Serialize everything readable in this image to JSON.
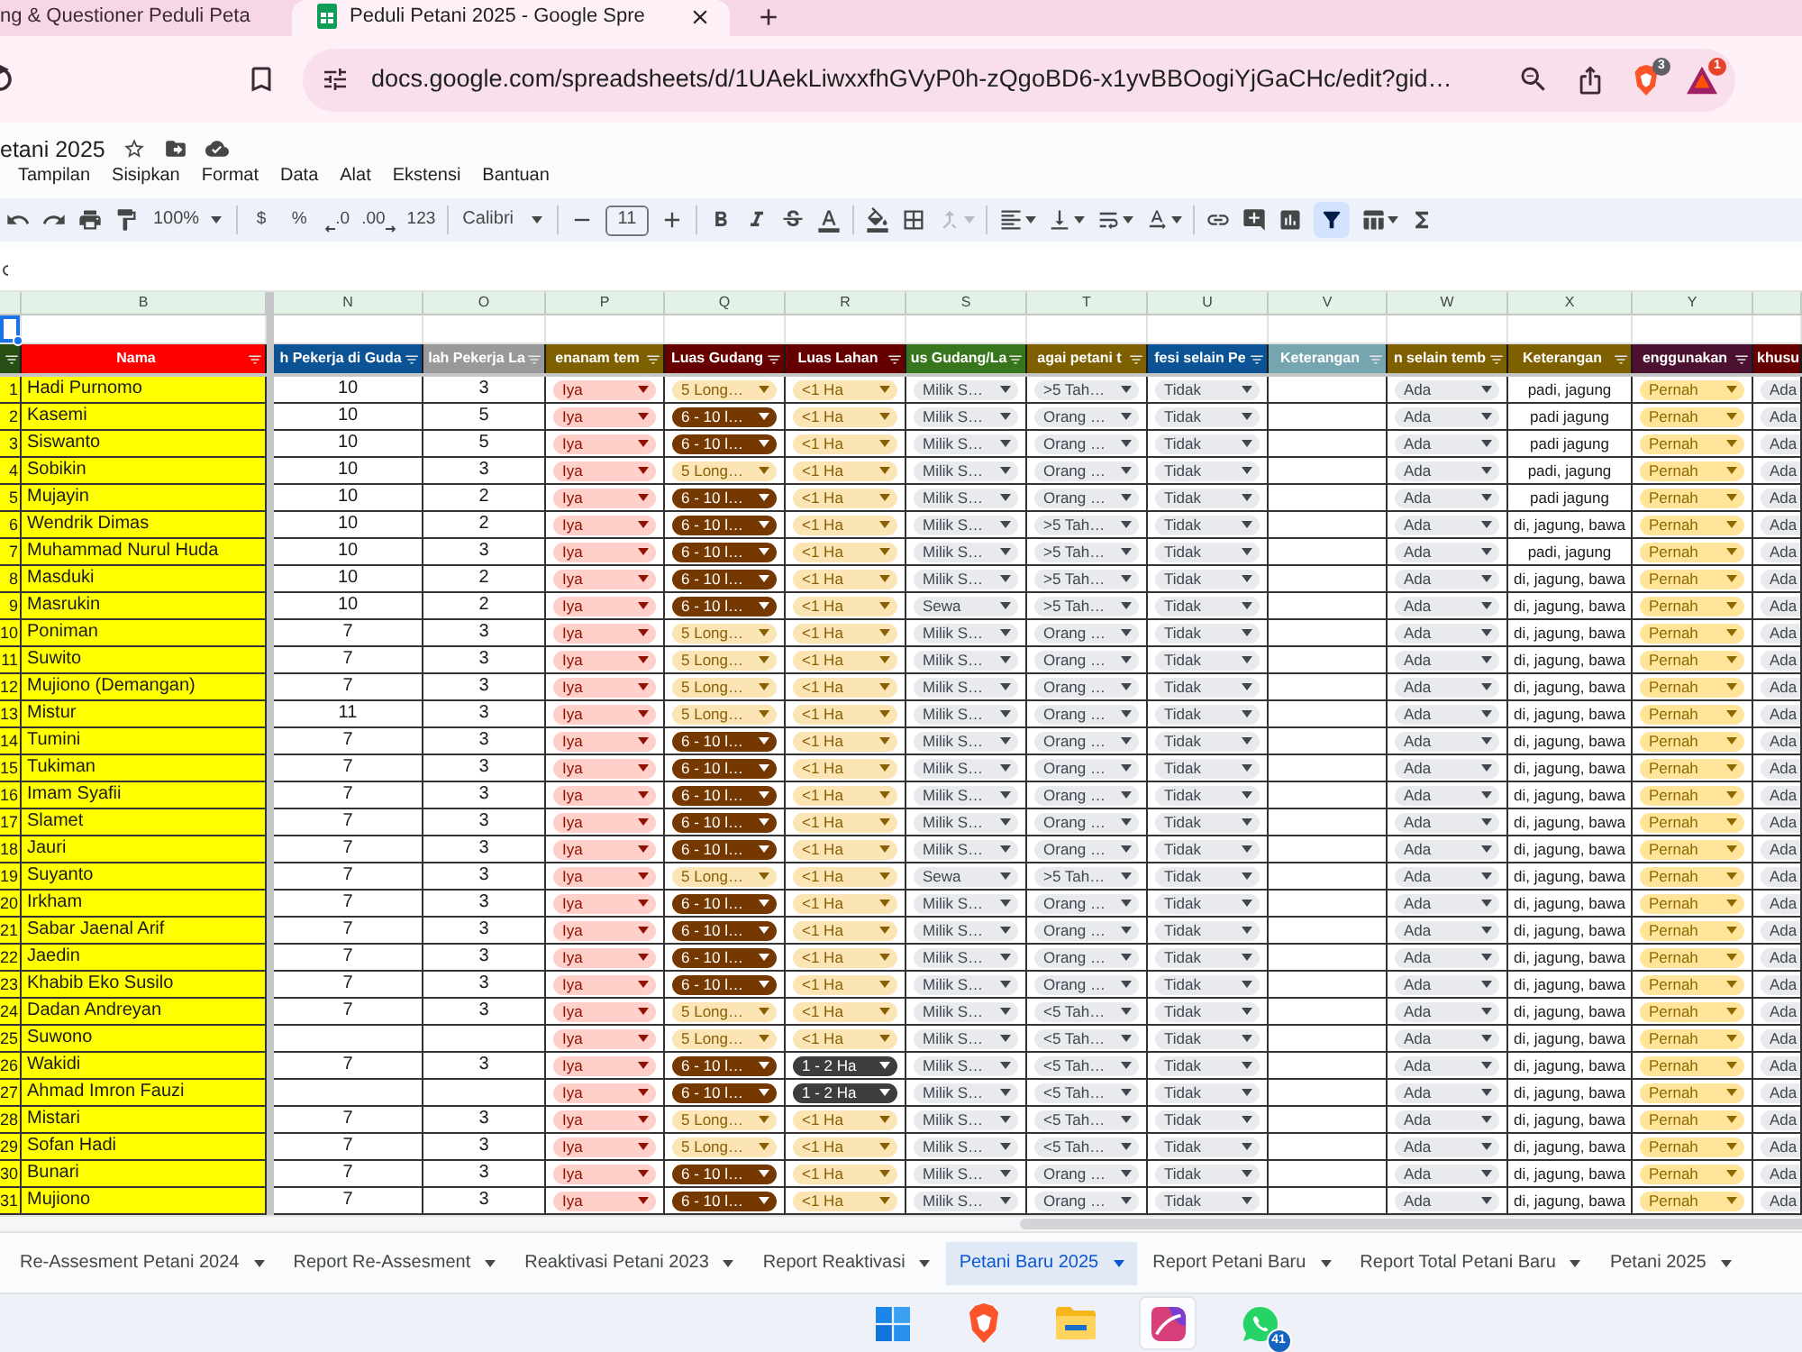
{
  "browser": {
    "tabs": [
      {
        "title": "ng & Questioner Peduli Peta",
        "selected": false
      },
      {
        "title": "Peduli Petani 2025 - Google Spre",
        "selected": true
      }
    ],
    "url": "docs.google.com/spreadsheets/d/1UAekLiwxxfhGVyP0h-zQgoBD6-x1yvBBOogiYjGaCHc/edit?gid…",
    "extensions": [
      {
        "kind": "shield",
        "badge": "3"
      },
      {
        "kind": "triangle",
        "badge": "1"
      }
    ]
  },
  "document": {
    "title": "etani 2025"
  },
  "menu": [
    "Tampilan",
    "Sisipkan",
    "Format",
    "Data",
    "Alat",
    "Ekstensi",
    "Bantuan"
  ],
  "toolbar": {
    "zoom": "100%",
    "formats": [
      {
        "label": "$",
        "kind": "plain"
      },
      {
        "label": "%",
        "kind": "plain"
      },
      {
        "label": ".0",
        "kind": "decrease"
      },
      {
        "label": ".00",
        "kind": "increase"
      },
      {
        "label": "123",
        "kind": "plain"
      }
    ],
    "font": "Calibri",
    "font_size": "11",
    "merge_disabled": true,
    "filter_on": true
  },
  "sheet": {
    "columns": [
      {
        "color": "#274e13",
        "kind": "index",
        "selected": true
      },
      {
        "letter": "B",
        "header": "Nama",
        "color": "#ff0000",
        "kind": "name",
        "selected": false
      },
      {
        "letter": "N",
        "header": "h Pekerja di Guda",
        "color": "#0b5394",
        "kind": "number",
        "selected": false
      },
      {
        "letter": "O",
        "header": "lah Pekerja La",
        "color": "#999999",
        "kind": "number",
        "selected": false
      },
      {
        "letter": "P",
        "header": "enanam tem",
        "color": "#7f6000",
        "kind": "chip",
        "chip": {
          "color": "#ffcfc9"
        },
        "selected": false
      },
      {
        "letter": "Q",
        "header": "Luas Gudang",
        "color": "#660000",
        "kind": "chip",
        "selected": false
      },
      {
        "letter": "R",
        "header": "Luas Lahan",
        "color": "#660000",
        "kind": "chip",
        "selected": false
      },
      {
        "letter": "S",
        "header": "us Gudang/La",
        "color": "#38761d",
        "kind": "chip",
        "chip": {
          "color": "#e8eaed"
        },
        "selected": false
      },
      {
        "letter": "T",
        "header": "agai petani t",
        "color": "#7f6000",
        "kind": "chip",
        "chip": {
          "color": "#e8eaed"
        },
        "selected": false
      },
      {
        "letter": "U",
        "header": "fesi selain Pe",
        "color": "#0b5394",
        "kind": "chip",
        "chip": {
          "color": "#e8eaed"
        },
        "selected": false
      },
      {
        "letter": "V",
        "header": "Keterangan",
        "color": "#76a5af",
        "kind": "note",
        "selected": false
      },
      {
        "letter": "W",
        "header": "n selain temb",
        "color": "#7f6000",
        "kind": "chip",
        "chip": {
          "color": "#e8eaed"
        },
        "selected": false
      },
      {
        "letter": "X",
        "header": "Keterangan",
        "color": "#7f6000",
        "kind": "note",
        "selected": false
      },
      {
        "letter": "Y",
        "header": "enggunakan",
        "color": "#4c1130",
        "kind": "chip",
        "chip": {
          "color": "#ffe49a"
        },
        "selected": false
      },
      {
        "header": "khusu",
        "color": "#660000",
        "kind": "chip",
        "chip": {
          "color": "#e8eaed"
        },
        "cut": true,
        "selected": false
      }
    ],
    "rows": [
      {
        "cells": [
          "1",
          "Hadi Purnomo",
          "10",
          "3",
          "Iya",
          {
            "value": "5 Long…",
            "color": "#fce5b4"
          },
          {
            "value": "<1 Ha",
            "color": "#fce5b4"
          },
          "Milik S…",
          ">5 Tah…",
          "Tidak",
          null,
          "Ada",
          "padi, jagung",
          "Pernah",
          "Ada"
        ]
      },
      {
        "cells": [
          "2",
          "Kasemi",
          "10",
          "5",
          "Iya",
          {
            "value": "6 - 10 l…",
            "color": "#753800"
          },
          {
            "value": "<1 Ha",
            "color": "#fce5b4"
          },
          "Milik S…",
          "Orang …",
          "Tidak",
          null,
          "Ada",
          "padi jagung",
          "Pernah",
          "Ada"
        ]
      },
      {
        "cells": [
          "3",
          "Siswanto",
          "10",
          "5",
          "Iya",
          {
            "value": "6 - 10 l…",
            "color": "#753800"
          },
          {
            "value": "<1 Ha",
            "color": "#fce5b4"
          },
          "Milik S…",
          "Orang …",
          "Tidak",
          null,
          "Ada",
          "padi jagung",
          "Pernah",
          "Ada"
        ]
      },
      {
        "cells": [
          "4",
          "Sobikin",
          "10",
          "3",
          "Iya",
          {
            "value": "5 Long…",
            "color": "#fce5b4"
          },
          {
            "value": "<1 Ha",
            "color": "#fce5b4"
          },
          "Milik S…",
          "Orang …",
          "Tidak",
          null,
          "Ada",
          "padi, jagung",
          "Pernah",
          "Ada"
        ]
      },
      {
        "cells": [
          "5",
          "Mujayin",
          "10",
          "2",
          "Iya",
          {
            "value": "6 - 10 l…",
            "color": "#753800"
          },
          {
            "value": "<1 Ha",
            "color": "#fce5b4"
          },
          "Milik S…",
          "Orang …",
          "Tidak",
          null,
          "Ada",
          "padi jagung",
          "Pernah",
          "Ada"
        ]
      },
      {
        "cells": [
          "6",
          "Wendrik Dimas",
          "10",
          "2",
          "Iya",
          {
            "value": "6 - 10 l…",
            "color": "#753800"
          },
          {
            "value": "<1 Ha",
            "color": "#fce5b4"
          },
          "Milik S…",
          ">5 Tah…",
          "Tidak",
          null,
          "Ada",
          "di, jagung, bawa",
          "Pernah",
          "Ada"
        ]
      },
      {
        "cells": [
          "7",
          "Muhammad Nurul Huda",
          "10",
          "3",
          "Iya",
          {
            "value": "6 - 10 l…",
            "color": "#753800"
          },
          {
            "value": "<1 Ha",
            "color": "#fce5b4"
          },
          "Milik S…",
          ">5 Tah…",
          "Tidak",
          null,
          "Ada",
          "padi, jagung",
          "Pernah",
          "Ada"
        ]
      },
      {
        "cells": [
          "8",
          "Masduki",
          "10",
          "2",
          "Iya",
          {
            "value": "6 - 10 l…",
            "color": "#753800"
          },
          {
            "value": "<1 Ha",
            "color": "#fce5b4"
          },
          "Milik S…",
          ">5 Tah…",
          "Tidak",
          null,
          "Ada",
          "di, jagung, bawa",
          "Pernah",
          "Ada"
        ]
      },
      {
        "cells": [
          "9",
          "Masrukin",
          "10",
          "2",
          "Iya",
          {
            "value": "6 - 10 l…",
            "color": "#753800"
          },
          {
            "value": "<1 Ha",
            "color": "#fce5b4"
          },
          "Sewa",
          ">5 Tah…",
          "Tidak",
          null,
          "Ada",
          "di, jagung, bawa",
          "Pernah",
          "Ada"
        ]
      },
      {
        "cells": [
          "10",
          "Poniman",
          "7",
          "3",
          "Iya",
          {
            "value": "5 Long…",
            "color": "#fce5b4"
          },
          {
            "value": "<1 Ha",
            "color": "#fce5b4"
          },
          "Milik S…",
          "Orang …",
          "Tidak",
          null,
          "Ada",
          "di, jagung, bawa",
          "Pernah",
          "Ada"
        ]
      },
      {
        "cells": [
          "11",
          "Suwito",
          "7",
          "3",
          "Iya",
          {
            "value": "5 Long…",
            "color": "#fce5b4"
          },
          {
            "value": "<1 Ha",
            "color": "#fce5b4"
          },
          "Milik S…",
          "Orang …",
          "Tidak",
          null,
          "Ada",
          "di, jagung, bawa",
          "Pernah",
          "Ada"
        ]
      },
      {
        "cells": [
          "12",
          "Mujiono (Demangan)",
          "7",
          "3",
          "Iya",
          {
            "value": "5 Long…",
            "color": "#fce5b4"
          },
          {
            "value": "<1 Ha",
            "color": "#fce5b4"
          },
          "Milik S…",
          "Orang …",
          "Tidak",
          null,
          "Ada",
          "di, jagung, bawa",
          "Pernah",
          "Ada"
        ]
      },
      {
        "cells": [
          "13",
          "Mistur",
          "11",
          "3",
          "Iya",
          {
            "value": "5 Long…",
            "color": "#fce5b4"
          },
          {
            "value": "<1 Ha",
            "color": "#fce5b4"
          },
          "Milik S…",
          "Orang …",
          "Tidak",
          null,
          "Ada",
          "di, jagung, bawa",
          "Pernah",
          "Ada"
        ]
      },
      {
        "cells": [
          "14",
          "Tumini",
          "7",
          "3",
          "Iya",
          {
            "value": "6 - 10 l…",
            "color": "#753800"
          },
          {
            "value": "<1 Ha",
            "color": "#fce5b4"
          },
          "Milik S…",
          "Orang …",
          "Tidak",
          null,
          "Ada",
          "di, jagung, bawa",
          "Pernah",
          "Ada"
        ]
      },
      {
        "cells": [
          "15",
          "Tukiman",
          "7",
          "3",
          "Iya",
          {
            "value": "6 - 10 l…",
            "color": "#753800"
          },
          {
            "value": "<1 Ha",
            "color": "#fce5b4"
          },
          "Milik S…",
          "Orang …",
          "Tidak",
          null,
          "Ada",
          "di, jagung, bawa",
          "Pernah",
          "Ada"
        ]
      },
      {
        "cells": [
          "16",
          "Imam Syafii",
          "7",
          "3",
          "Iya",
          {
            "value": "6 - 10 l…",
            "color": "#753800"
          },
          {
            "value": "<1 Ha",
            "color": "#fce5b4"
          },
          "Milik S…",
          "Orang …",
          "Tidak",
          null,
          "Ada",
          "di, jagung, bawa",
          "Pernah",
          "Ada"
        ]
      },
      {
        "cells": [
          "17",
          "Slamet",
          "7",
          "3",
          "Iya",
          {
            "value": "6 - 10 l…",
            "color": "#753800"
          },
          {
            "value": "<1 Ha",
            "color": "#fce5b4"
          },
          "Milik S…",
          "Orang …",
          "Tidak",
          null,
          "Ada",
          "di, jagung, bawa",
          "Pernah",
          "Ada"
        ]
      },
      {
        "cells": [
          "18",
          "Jauri",
          "7",
          "3",
          "Iya",
          {
            "value": "6 - 10 l…",
            "color": "#753800"
          },
          {
            "value": "<1 Ha",
            "color": "#fce5b4"
          },
          "Milik S…",
          "Orang …",
          "Tidak",
          null,
          "Ada",
          "di, jagung, bawa",
          "Pernah",
          "Ada"
        ]
      },
      {
        "cells": [
          "19",
          "Suyanto",
          "7",
          "3",
          "Iya",
          {
            "value": "5 Long…",
            "color": "#fce5b4"
          },
          {
            "value": "<1 Ha",
            "color": "#fce5b4"
          },
          "Sewa",
          ">5 Tah…",
          "Tidak",
          null,
          "Ada",
          "di, jagung, bawa",
          "Pernah",
          "Ada"
        ]
      },
      {
        "cells": [
          "20",
          "Irkham",
          "7",
          "3",
          "Iya",
          {
            "value": "6 - 10 l…",
            "color": "#753800"
          },
          {
            "value": "<1 Ha",
            "color": "#fce5b4"
          },
          "Milik S…",
          "Orang …",
          "Tidak",
          null,
          "Ada",
          "di, jagung, bawa",
          "Pernah",
          "Ada"
        ]
      },
      {
        "cells": [
          "21",
          "Sabar Jaenal Arif",
          "7",
          "3",
          "Iya",
          {
            "value": "6 - 10 l…",
            "color": "#753800"
          },
          {
            "value": "<1 Ha",
            "color": "#fce5b4"
          },
          "Milik S…",
          "Orang …",
          "Tidak",
          null,
          "Ada",
          "di, jagung, bawa",
          "Pernah",
          "Ada"
        ]
      },
      {
        "cells": [
          "22",
          "Jaedin",
          "7",
          "3",
          "Iya",
          {
            "value": "6 - 10 l…",
            "color": "#753800"
          },
          {
            "value": "<1 Ha",
            "color": "#fce5b4"
          },
          "Milik S…",
          "Orang …",
          "Tidak",
          null,
          "Ada",
          "di, jagung, bawa",
          "Pernah",
          "Ada"
        ]
      },
      {
        "cells": [
          "23",
          "Khabib Eko Susilo",
          "7",
          "3",
          "Iya",
          {
            "value": "6 - 10 l…",
            "color": "#753800"
          },
          {
            "value": "<1 Ha",
            "color": "#fce5b4"
          },
          "Milik S…",
          "Orang …",
          "Tidak",
          null,
          "Ada",
          "di, jagung, bawa",
          "Pernah",
          "Ada"
        ]
      },
      {
        "cells": [
          "24",
          "Dadan Andreyan",
          "7",
          "3",
          "Iya",
          {
            "value": "5 Long…",
            "color": "#fce5b4"
          },
          {
            "value": "<1 Ha",
            "color": "#fce5b4"
          },
          "Milik S…",
          "<5 Tah…",
          "Tidak",
          null,
          "Ada",
          "di, jagung, bawa",
          "Pernah",
          "Ada"
        ]
      },
      {
        "cells": [
          "25",
          "Suwono",
          null,
          null,
          "Iya",
          {
            "value": "5 Long…",
            "color": "#fce5b4"
          },
          {
            "value": "<1 Ha",
            "color": "#fce5b4"
          },
          "Milik S…",
          "<5 Tah…",
          "Tidak",
          null,
          "Ada",
          "di, jagung, bawa",
          "Pernah",
          "Ada"
        ]
      },
      {
        "cells": [
          "26",
          "Wakidi",
          "7",
          "3",
          "Iya",
          {
            "value": "6 - 10 l…",
            "color": "#753800"
          },
          {
            "value": "1 - 2 Ha",
            "color": "#3d3d3d"
          },
          "Milik S…",
          "<5 Tah…",
          "Tidak",
          null,
          "Ada",
          "di, jagung, bawa",
          "Pernah",
          "Ada"
        ]
      },
      {
        "cells": [
          "27",
          "Ahmad Imron Fauzi",
          null,
          null,
          "Iya",
          {
            "value": "6 - 10 l…",
            "color": "#753800"
          },
          {
            "value": "1 - 2 Ha",
            "color": "#3d3d3d"
          },
          "Milik S…",
          "<5 Tah…",
          "Tidak",
          null,
          "Ada",
          "di, jagung, bawa",
          "Pernah",
          "Ada"
        ]
      },
      {
        "cells": [
          "28",
          "Mistari",
          "7",
          "3",
          "Iya",
          {
            "value": "5 Long…",
            "color": "#fce5b4"
          },
          {
            "value": "<1 Ha",
            "color": "#fce5b4"
          },
          "Milik S…",
          "<5 Tah…",
          "Tidak",
          null,
          "Ada",
          "di, jagung, bawa",
          "Pernah",
          "Ada"
        ]
      },
      {
        "cells": [
          "29",
          "Sofan Hadi",
          "7",
          "3",
          "Iya",
          {
            "value": "5 Long…",
            "color": "#fce5b4"
          },
          {
            "value": "<1 Ha",
            "color": "#fce5b4"
          },
          "Milik S…",
          "<5 Tah…",
          "Tidak",
          null,
          "Ada",
          "di, jagung, bawa",
          "Pernah",
          "Ada"
        ]
      },
      {
        "cells": [
          "30",
          "Bunari",
          "7",
          "3",
          "Iya",
          {
            "value": "6 - 10 l…",
            "color": "#753800"
          },
          {
            "value": "<1 Ha",
            "color": "#fce5b4"
          },
          "Milik S…",
          "Orang …",
          "Tidak",
          null,
          "Ada",
          "di, jagung, bawa",
          "Pernah",
          "Ada"
        ]
      },
      {
        "cells": [
          "31",
          "Mujiono",
          "7",
          "3",
          "Iya",
          {
            "value": "6 - 10 l…",
            "color": "#753800"
          },
          {
            "value": "<1 Ha",
            "color": "#fce5b4"
          },
          "Milik S…",
          "Orang …",
          "Tidak",
          null,
          "Ada",
          "di, jagung, bawa",
          "Pernah",
          "Ada"
        ]
      }
    ]
  },
  "sheet_tabs": [
    {
      "label": "Re-Assesment Petani 2024",
      "selected": false
    },
    {
      "label": "Report Re-Assesment",
      "selected": false
    },
    {
      "label": "Reaktivasi Petani 2023",
      "selected": false
    },
    {
      "label": "Report Reaktivasi",
      "selected": false
    },
    {
      "label": "Petani Baru 2025",
      "selected": true
    },
    {
      "label": "Report Petani Baru",
      "selected": false
    },
    {
      "label": "Report Total Petani Baru",
      "selected": false
    },
    {
      "label": "Petani 2025",
      "selected": false
    }
  ],
  "taskbar": [
    {
      "kind": "start",
      "selected": false
    },
    {
      "kind": "browser",
      "selected": false
    },
    {
      "kind": "folder",
      "selected": false
    },
    {
      "kind": "app",
      "selected": true
    },
    {
      "kind": "chat",
      "selected": false,
      "badge": "41"
    }
  ]
}
